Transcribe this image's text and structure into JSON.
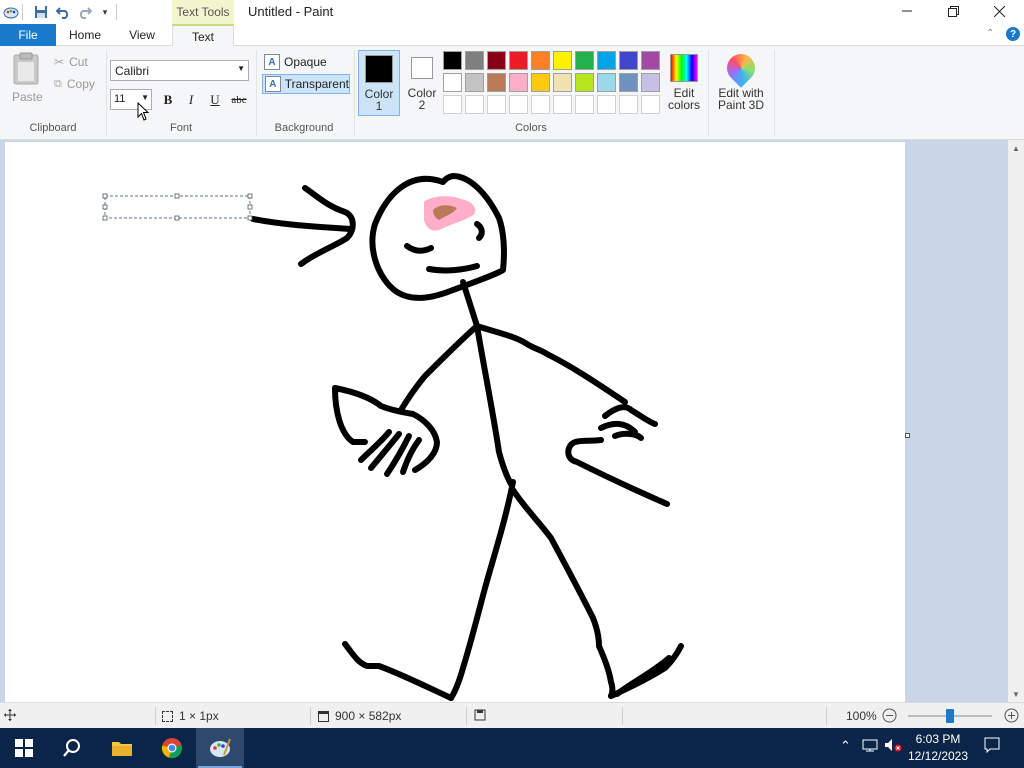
{
  "titlebar": {
    "context_tab": "Text Tools",
    "title": "Untitled - Paint",
    "minimize": "—",
    "maximize": "❐",
    "close": "✕"
  },
  "tabs": {
    "file": "File",
    "home": "Home",
    "view": "View",
    "text": "Text"
  },
  "ribbon": {
    "clipboard": {
      "label": "Clipboard",
      "paste": "Paste",
      "cut": "Cut",
      "copy": "Copy"
    },
    "font": {
      "label": "Font",
      "family": "Calibri",
      "size": "11",
      "bold": "B",
      "italic": "I",
      "underline": "U",
      "strikethrough": "abc"
    },
    "background": {
      "label": "Background",
      "opaque": "Opaque",
      "transparent": "Transparent",
      "selected": "Transparent"
    },
    "colors": {
      "label": "Colors",
      "color1_label": "Color 1",
      "color2_label": "Color 2",
      "color1": "#000000",
      "color2": "#ffffff",
      "palette_row1": [
        "#000000",
        "#7f7f7f",
        "#880015",
        "#ed1c24",
        "#ff7f27",
        "#fff200",
        "#22b14c",
        "#00a2e8",
        "#3f48cc",
        "#a349a4"
      ],
      "palette_row2": [
        "#ffffff",
        "#c3c3c3",
        "#b97a57",
        "#ffaec9",
        "#ffc90e",
        "#efe4b0",
        "#b5e61d",
        "#99d9ea",
        "#7092be",
        "#c8bfe7"
      ],
      "palette_row3": [
        "#ffffff",
        "#ffffff",
        "#ffffff",
        "#ffffff",
        "#ffffff",
        "#ffffff",
        "#ffffff",
        "#ffffff",
        "#ffffff",
        "#ffffff"
      ],
      "edit_colors": "Edit colors"
    },
    "edit_paint3d": "Edit with Paint 3D"
  },
  "statusbar": {
    "selection_size": "1 × 1px",
    "image_size": "900 × 582px",
    "zoom": "100%",
    "zoom_level": 0.5
  },
  "taskbar": {
    "time": "6:03 PM",
    "date": "12/12/2023"
  }
}
